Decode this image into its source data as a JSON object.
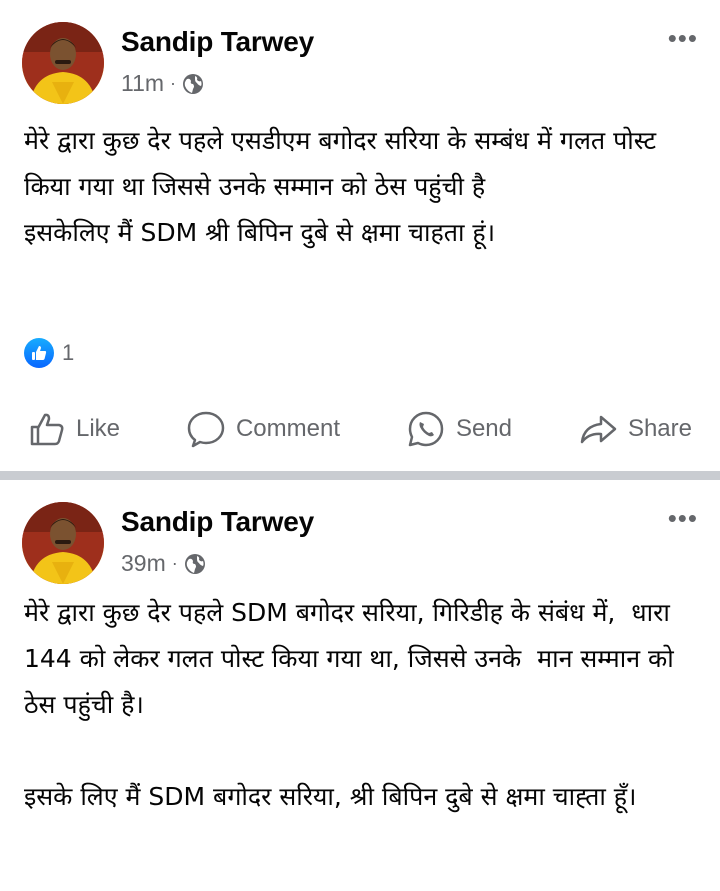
{
  "posts": [
    {
      "author": "Sandip Tarwey",
      "time": "11m",
      "separator": "·",
      "text": "मेरे द्वारा कुछ देर पहले एसडीएम बगोदर सरिया के सम्बंध में गलत पोस्ट किया गया था जिससे उनके सम्मान को ठेस पहुंची है\nइसकेलिए मैं SDM श्री बिपिन दुबे से क्षमा चाहता हूं।",
      "reaction_count": "1",
      "actions": {
        "like": "Like",
        "comment": "Comment",
        "send": "Send",
        "share": "Share"
      }
    },
    {
      "author": "Sandip Tarwey",
      "time": "39m",
      "separator": "·",
      "text": "मेरे द्वारा कुछ देर पहले SDM बगोदर सरिया, गिरिडीह के संबंध में,  धारा 144 को लेकर गलत पोस्ट किया गया था, जिससे उनके  मान सम्मान को ठेस पहुंची है।\n\nइसके लिए मैं SDM बगोदर सरिया, श्री बिपिन दुबे से क्षमा चाह्ता हूँ।"
    }
  ],
  "icons": {
    "more": "more-options-icon",
    "audience": "globe-icon",
    "reaction": "like-reaction-icon"
  },
  "colors": {
    "text": "#050505",
    "secondary": "#65676b",
    "like_blue": "#0866ff",
    "separator": "#c9ccd1"
  }
}
